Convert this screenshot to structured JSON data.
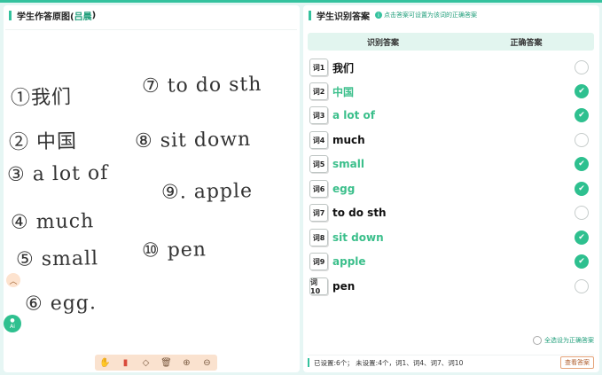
{
  "left": {
    "title": "学生作答原图(",
    "student_name": "吕晨",
    "title_close": ")",
    "handwriting": [
      "①我们",
      "⑦ to do sth",
      "② 中国",
      "⑧ sit down",
      "③ a lot of",
      "⑨. apple",
      "④ much",
      "⑤ small",
      "⑩ pen",
      "⑥ egg."
    ],
    "ai_label": "Ai"
  },
  "right": {
    "title": "学生识别答案",
    "hint_icon": "i",
    "hint": "点击答案可设置为该词的正确答案",
    "col_recognized": "识别答案",
    "col_correct": "正确答案",
    "rows": [
      {
        "tag": "词1",
        "word": "我们",
        "correct": false
      },
      {
        "tag": "词2",
        "word": "中国",
        "correct": true
      },
      {
        "tag": "词3",
        "word": "a lot of",
        "correct": true
      },
      {
        "tag": "词4",
        "word": "much",
        "correct": false
      },
      {
        "tag": "词5",
        "word": "small",
        "correct": true
      },
      {
        "tag": "词6",
        "word": "egg",
        "correct": true
      },
      {
        "tag": "词7",
        "word": "to do sth",
        "correct": false
      },
      {
        "tag": "词8",
        "word": "sit down",
        "correct": true
      },
      {
        "tag": "词9",
        "word": "apple",
        "correct": true
      },
      {
        "tag": "词10",
        "word": "pen",
        "correct": false
      }
    ],
    "select_all": "全选设为正确答案",
    "summary": "已设置:6个； 未设置:4个，词1、词4、词7、词10",
    "view_button": "查看答案"
  },
  "colors": {
    "accent": "#34c29e",
    "correct_text": "#3bbf8b",
    "background": "#e6f6f4"
  },
  "icons": {
    "tools": [
      "hand-icon",
      "eraser-icon",
      "rubber-icon",
      "trash-icon",
      "zoom-in-icon",
      "zoom-out-icon"
    ]
  }
}
